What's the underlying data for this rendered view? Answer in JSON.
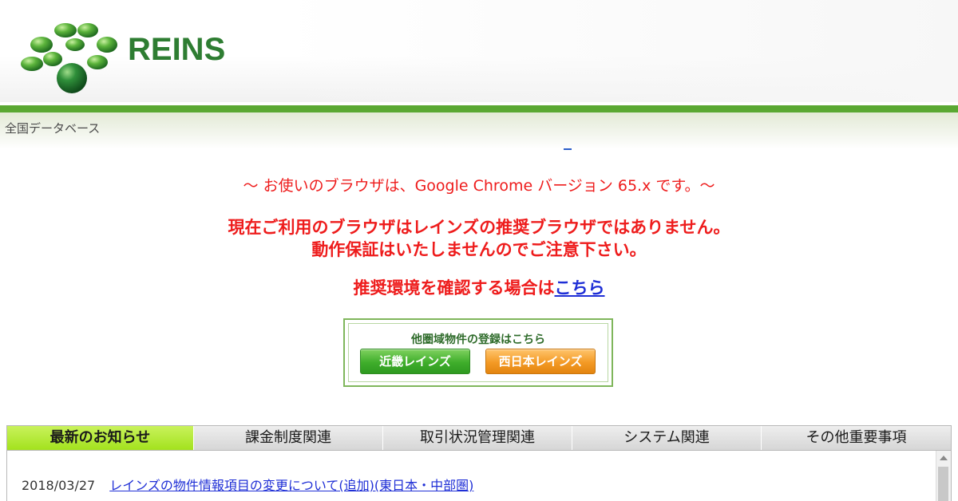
{
  "header": {
    "brand": "REINS",
    "subtitle": "全国データベース",
    "logo_icon": "reins-clover-logo"
  },
  "messages": {
    "browser_notice": "〜 お使いのブラウザは、Google Chrome バージョン 65.x です。〜",
    "warning_line1": "現在ご利用のブラウザはレインズの推奨ブラウザではありません。",
    "warning_line2": "動作保証はいたしませんのでご注意下さい。",
    "recommend_prefix": "推奨環境を確認する場合は",
    "recommend_link": "こちら"
  },
  "region": {
    "caption": "他圏域物件の登録はこちら",
    "kinki_label": "近畿レインズ",
    "west_label": "西日本レインズ"
  },
  "tabs": [
    {
      "label": "最新のお知らせ",
      "active": true
    },
    {
      "label": "課金制度関連",
      "active": false
    },
    {
      "label": "取引状況管理関連",
      "active": false
    },
    {
      "label": "システム関連",
      "active": false
    },
    {
      "label": "その他重要事項",
      "active": false
    }
  ],
  "news": [
    {
      "date": "2018/03/27",
      "title": "レインズの物件情報項目の変更について(追加)(東日本・中部圏)"
    }
  ],
  "colors": {
    "brand_green": "#2e7d32",
    "warning_red": "#ee1c1c",
    "link_blue": "#1f2fd6",
    "active_tab": "#a3e21d"
  }
}
